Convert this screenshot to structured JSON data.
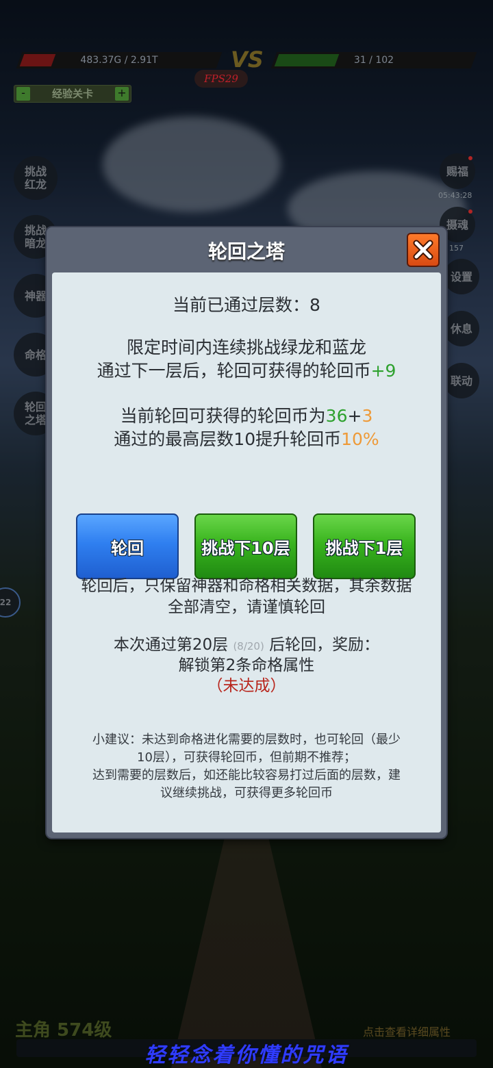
{
  "hud": {
    "player_hp": "483.37G / 2.91T",
    "vs": "VS",
    "enemy_hp": "31 / 102",
    "fps": "FPS29",
    "stage_minus": "-",
    "stage_label": "经验关卡",
    "stage_plus": "+"
  },
  "left_menu": [
    {
      "label": "挑战\n红龙"
    },
    {
      "label": "挑战\n暗龙"
    },
    {
      "label": "神器"
    },
    {
      "label": "命格"
    },
    {
      "label": "轮回\n之塔"
    }
  ],
  "right_menu": {
    "bless": "赐福",
    "bless_timer": "05:43:28",
    "soul": "摄魂",
    "soul_count": "157",
    "settings": "设置",
    "rest": "休息",
    "link": "联动"
  },
  "side_circle_value": "22",
  "dialog": {
    "title": "轮回之塔",
    "close": "close",
    "current_floors_label": "当前已通过层数：",
    "current_floors_value": "8",
    "desc1": "限定时间内连续挑战绿龙和蓝龙",
    "desc2_prefix": "通过下一层后，轮回可获得的轮回币",
    "desc2_bonus": "+9",
    "coins_prefix": "当前轮回可获得的轮回币为",
    "coins_base": "36",
    "coins_plus": "+",
    "coins_extra": "3",
    "boost_prefix": "通过的最高层数10提升轮回币",
    "boost_value": "10%",
    "buttons": {
      "reincarnate": "轮回",
      "challenge10": "挑战下10层",
      "challenge1": "挑战下1层"
    },
    "warning1": "轮回后，只保留神器和命格相关数据，其余数据",
    "warning2": "全部清空，请谨慎轮回",
    "reward_prefix": "本次通过第20层",
    "reward_progress": "(8/20)",
    "reward_suffix": "后轮回，奖励：",
    "reward_item": "解锁第2条命格属性",
    "reward_status": "（未达成）",
    "tip1": "小建议：未达到命格进化需要的层数时，也可轮回（最少",
    "tip2": "10层），可获得轮回币，但前期不推荐；",
    "tip3": "达到需要的层数后，如还能比较容易打过后面的层数，建",
    "tip4": "议继续挑战，可获得更多轮回币"
  },
  "footer": {
    "hero": "主角 574级",
    "detail": "点击查看详细属性",
    "slogan": "轻轻念着你懂的咒语"
  }
}
